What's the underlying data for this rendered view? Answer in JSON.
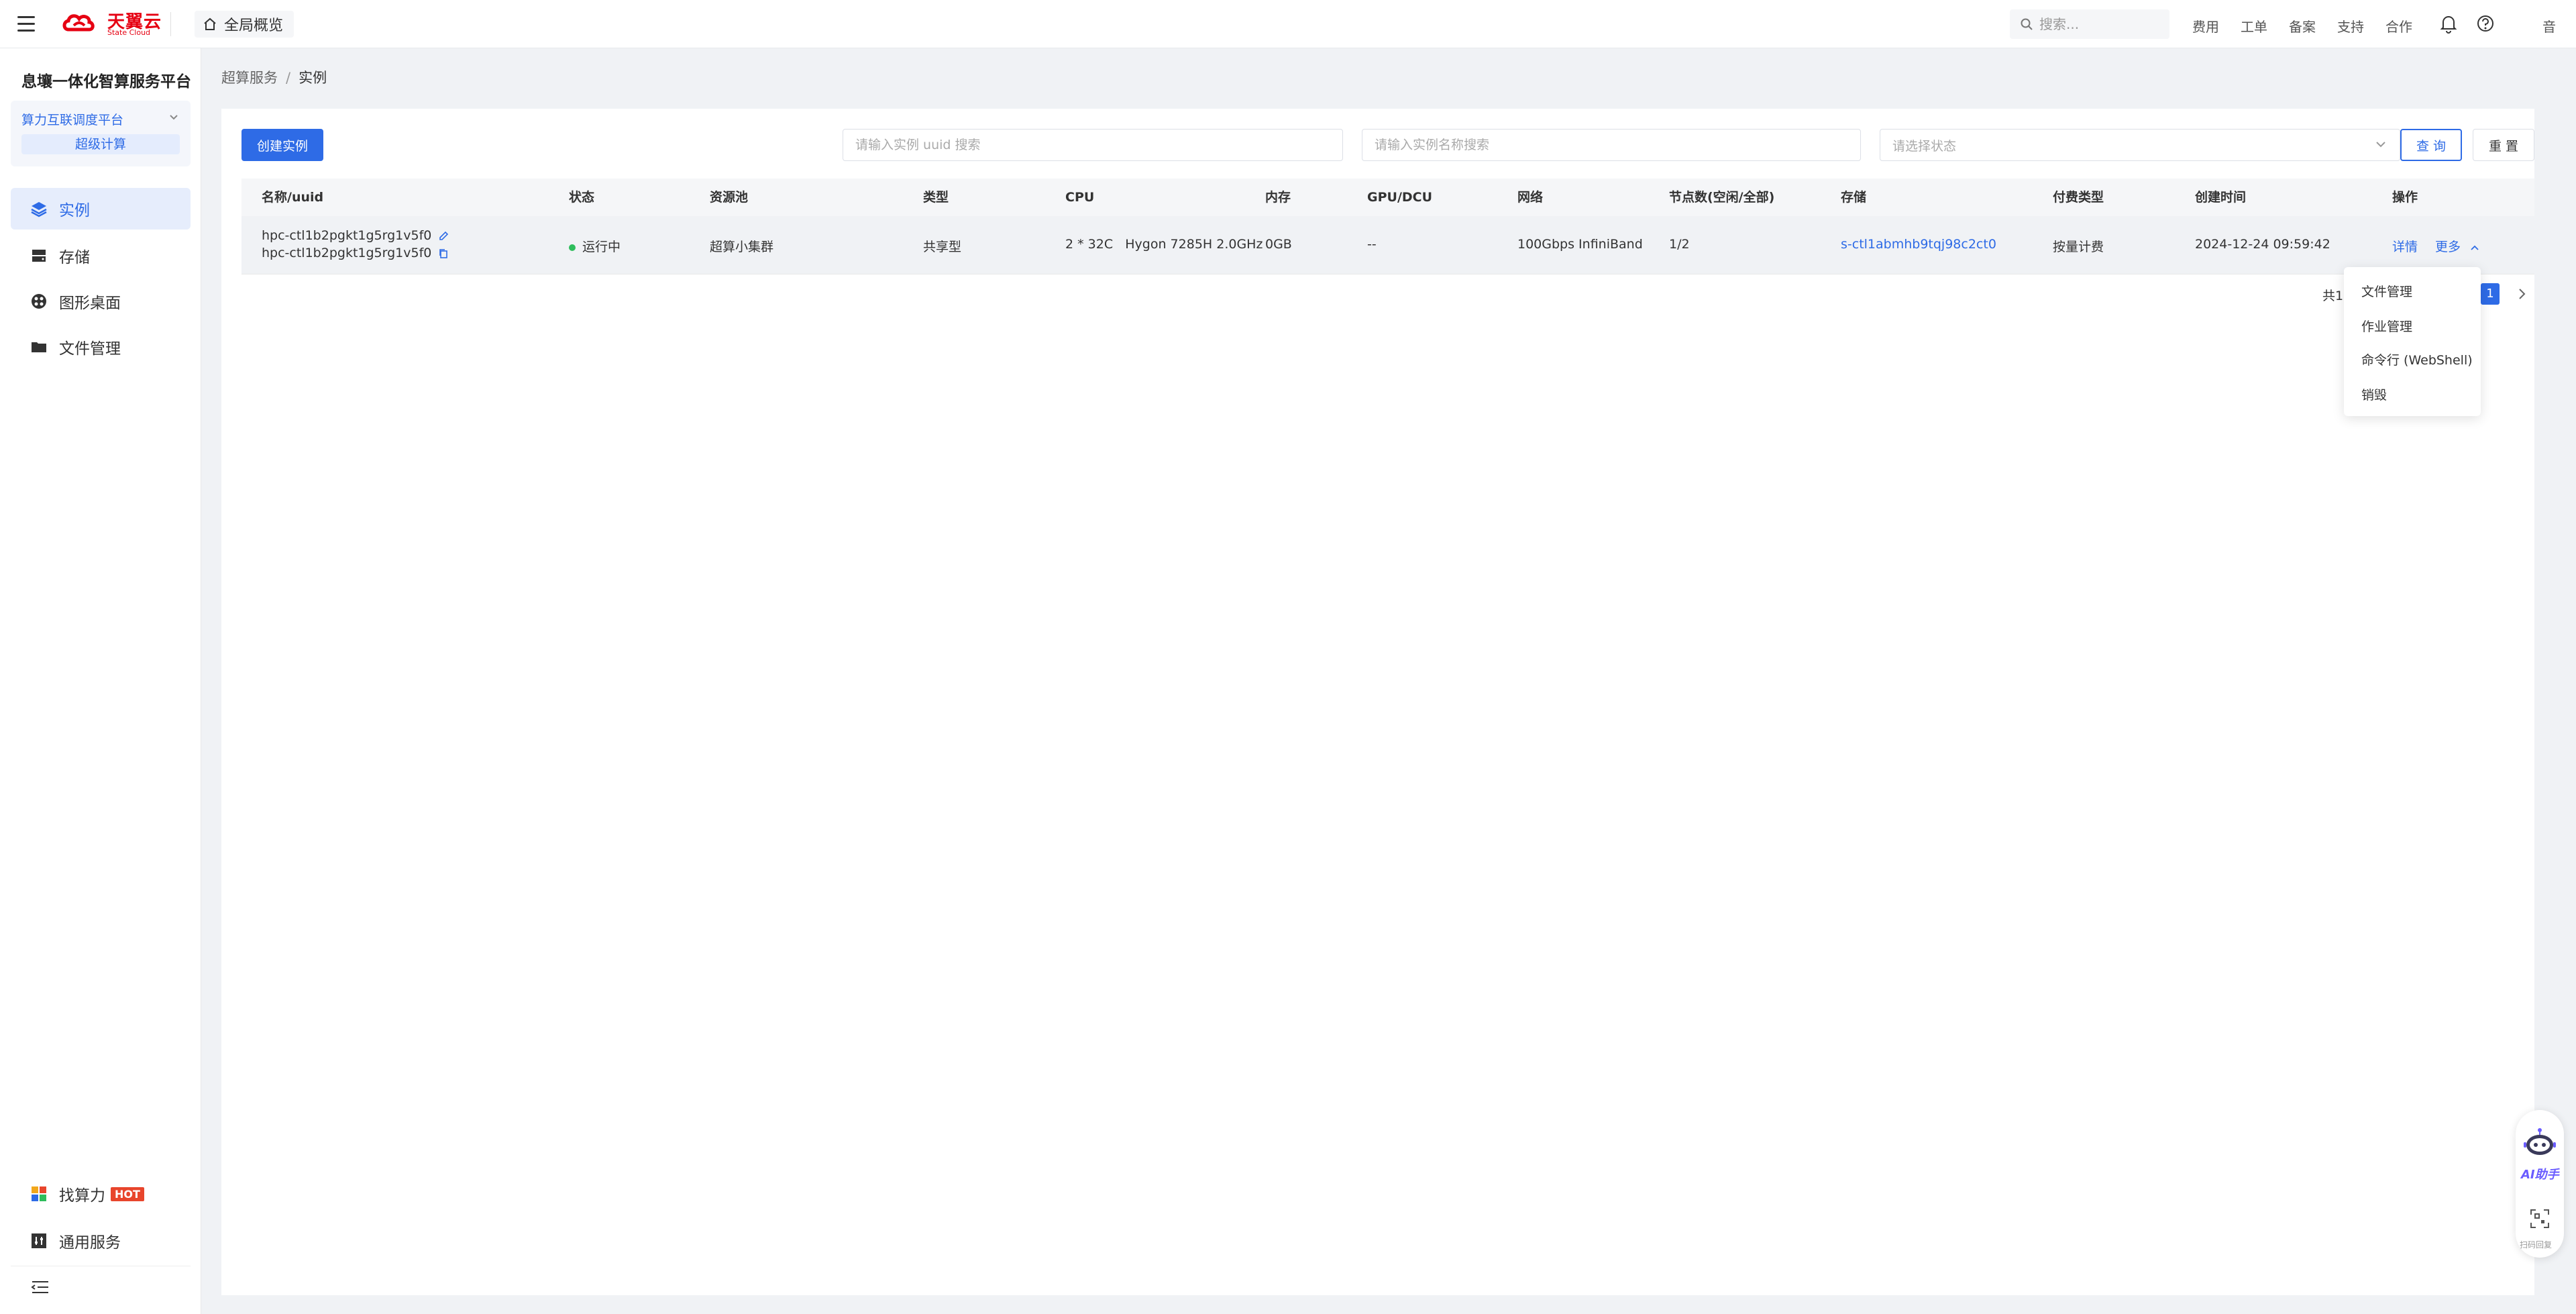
{
  "app": {
    "brand_name": "天翼云",
    "brand_sub": "State Cloud",
    "home_label": "全局概览"
  },
  "topbar": {
    "search_placeholder": "搜索...",
    "nav": [
      "费用",
      "工单",
      "备案",
      "支持",
      "合作"
    ],
    "user_label": "音"
  },
  "sidebar": {
    "platform_title": "息壤一体化智算服务平台",
    "platform_name": "算力互联调度平台",
    "platform_sub": "超级计算",
    "items": [
      {
        "label": "实例",
        "icon": "layers-icon",
        "active": true
      },
      {
        "label": "存储",
        "icon": "storage-icon",
        "active": false
      },
      {
        "label": "图形桌面",
        "icon": "desktop-icon",
        "active": false
      },
      {
        "label": "文件管理",
        "icon": "folder-icon",
        "active": false
      }
    ],
    "bottom_items": [
      {
        "label": "找算力",
        "icon": "grid-icon",
        "badge": "HOT"
      },
      {
        "label": "通用服务",
        "icon": "services-icon"
      }
    ]
  },
  "breadcrumb": [
    "超算服务",
    "实例"
  ],
  "toolbar": {
    "create_label": "创建实例",
    "uuid_placeholder": "请输入实例 uuid 搜索",
    "name_placeholder": "请输入实例名称搜索",
    "status_placeholder": "请选择状态",
    "query_label": "查 询",
    "reset_label": "重 置"
  },
  "table": {
    "columns": [
      "名称/uuid",
      "状态",
      "资源池",
      "类型",
      "CPU",
      "内存",
      "GPU/DCU",
      "网络",
      "节点数(空闲/全部)",
      "存储",
      "付费类型",
      "创建时间",
      "操作"
    ],
    "rows": [
      {
        "name": "hpc-ctl1b2pgkt1g5rg1v5f0",
        "uuid": "hpc-ctl1b2pgkt1g5rg1v5f0",
        "status": "运行中",
        "pool": "超算小集群",
        "type": "共享型",
        "cpu": "2 * 32C",
        "cpu_model": "Hygon 7285H 2.0GHz",
        "memory": "0GB",
        "gpu": "--",
        "network": "100Gbps InfiniBand",
        "nodes": "1/2",
        "storage": "s-ctl1abmhb9tqj98c2ct0",
        "billing": "按量计费",
        "created": "2024-12-24 09:59:42",
        "op_detail": "详情",
        "op_more": "更多"
      }
    ]
  },
  "pagination": {
    "total_label": "共1",
    "current": "1"
  },
  "more_menu": [
    "文件管理",
    "作业管理",
    "命令行 (WebShell)",
    "销毁"
  ],
  "float_widget": {
    "ai_label": "AI助手",
    "scan_label": "扫码回复"
  },
  "colors": {
    "primary": "#2e6be6",
    "brand": "#e60012",
    "status_running": "#2ebd5c",
    "hot_badge": "#e8452c"
  }
}
